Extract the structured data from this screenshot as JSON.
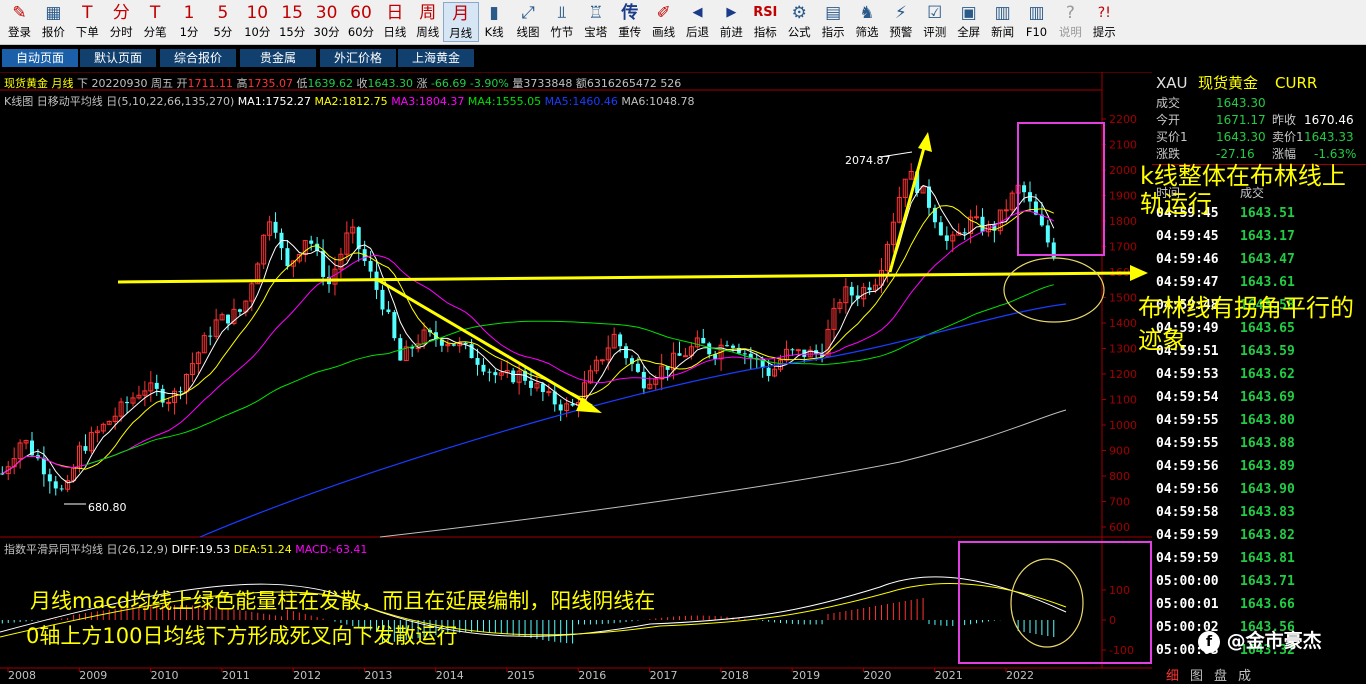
{
  "toolbar": [
    {
      "name": "login",
      "icon": "✎",
      "label": "登录"
    },
    {
      "name": "quote",
      "icon": "▦",
      "label": "报价"
    },
    {
      "name": "order",
      "icon": "T",
      "label": "下单"
    },
    {
      "name": "min-share",
      "icon": "分",
      "label": "分时"
    },
    {
      "name": "tick",
      "icon": "T",
      "label": "分笔"
    },
    {
      "name": "1min",
      "icon": "1",
      "label": "1分"
    },
    {
      "name": "5min",
      "icon": "5",
      "label": "5分"
    },
    {
      "name": "10min",
      "icon": "10",
      "label": "10分"
    },
    {
      "name": "15min",
      "icon": "15",
      "label": "15分"
    },
    {
      "name": "30min",
      "icon": "30",
      "label": "30分"
    },
    {
      "name": "60min",
      "icon": "60",
      "label": "60分"
    },
    {
      "name": "daily",
      "icon": "日",
      "label": "日线"
    },
    {
      "name": "weekly",
      "icon": "周",
      "label": "周线"
    },
    {
      "name": "monthly",
      "icon": "月",
      "label": "月线"
    },
    {
      "name": "kline",
      "icon": "▮",
      "label": "K线"
    },
    {
      "name": "line",
      "icon": "⤢",
      "label": "线图"
    },
    {
      "name": "bamboo",
      "icon": "⫫",
      "label": "竹节"
    },
    {
      "name": "pagoda",
      "icon": "♖",
      "label": "宝塔"
    },
    {
      "name": "overlay",
      "icon": "传",
      "label": "重传"
    },
    {
      "name": "draw",
      "icon": "✐",
      "label": "画线"
    },
    {
      "name": "back",
      "icon": "◀",
      "label": "后退"
    },
    {
      "name": "forward",
      "icon": "▶",
      "label": "前进"
    },
    {
      "name": "indicator",
      "icon": "RSI",
      "label": "指标"
    },
    {
      "name": "formula",
      "icon": "⚙",
      "label": "公式"
    },
    {
      "name": "guide",
      "icon": "▤",
      "label": "指示"
    },
    {
      "name": "filter",
      "icon": "♞",
      "label": "筛选"
    },
    {
      "name": "alert",
      "icon": "⚡",
      "label": "预警"
    },
    {
      "name": "review",
      "icon": "☑",
      "label": "评测"
    },
    {
      "name": "fullscreen",
      "icon": "▣",
      "label": "全屏"
    },
    {
      "name": "news",
      "icon": "▥",
      "label": "新闻"
    },
    {
      "name": "f10",
      "icon": "▥",
      "label": "F10"
    },
    {
      "name": "explain",
      "icon": "?",
      "label": "说明"
    },
    {
      "name": "tip",
      "icon": "?!",
      "label": "提示"
    }
  ],
  "tabs": [
    "自动页面",
    "默认页面",
    "综合报价",
    "贵金属",
    "外汇价格",
    "上海黄金"
  ],
  "info_bar": {
    "name": "现货黄金",
    "period": "月线",
    "dir": "下",
    "date": "20220930",
    "weekday": "周五",
    "open_label": "开",
    "open": "1711.11",
    "high_label": "高",
    "high": "1735.07",
    "low_label": "低",
    "low": "1639.62",
    "close_label": "收",
    "close": "1643.30",
    "chg_label": "涨",
    "chg": "-66.69",
    "pct": "-3.90%",
    "vol_label": "量",
    "vol": "3733848",
    "amt_label": "额",
    "amt": "6316265472",
    "extra": "526"
  },
  "ma_bar": {
    "title": "K线图 日移动平均线 日(5,10,22,66,135,270)",
    "ma1": "MA1:1752.27",
    "ma2": "MA2:1812.75",
    "ma3": "MA3:1804.37",
    "ma4": "MA4:1555.05",
    "ma5": "MA5:1460.46",
    "ma6": "MA6:1048.78"
  },
  "macd_bar": {
    "title": "指数平滑异同平均线 日(26,12,9)",
    "diff": "DIFF:19.53",
    "dea": "DEA:51.24",
    "macd": "MACD:-63.41"
  },
  "price_axis": [
    "2200",
    "2100",
    "2000",
    "1900",
    "1800",
    "1700",
    "1600",
    "1500",
    "1400",
    "1300",
    "1200",
    "1100",
    "1000",
    "900",
    "800",
    "700",
    "600"
  ],
  "macd_axis": [
    "100",
    "0",
    "-100"
  ],
  "year_axis": [
    "2008",
    "2009",
    "2010",
    "2011",
    "2012",
    "2013",
    "2014",
    "2015",
    "2016",
    "2017",
    "2018",
    "2019",
    "2020",
    "2021",
    "2022"
  ],
  "price_labels": {
    "high": "2074.87",
    "low": "680.80"
  },
  "right_panel": {
    "symbol": "XAU",
    "name": "现货黄金",
    "currency": "CURR",
    "last_label": "成交",
    "last": "1643.30",
    "open_label": "今开",
    "open": "1671.17",
    "prev_label": "昨收",
    "prev": "1670.46",
    "bid_label": "买价1",
    "bid": "1643.30",
    "ask_label": "卖价1",
    "ask": "1643.33",
    "chg_label": "涨跌",
    "chg": "-27.16",
    "pct_label": "涨幅",
    "pct": "-1.63%",
    "tick_header_time": "时间",
    "tick_header_price": "成交",
    "ticks": [
      [
        "04:59:45",
        "1643.51"
      ],
      [
        "04:59:45",
        "1643.17"
      ],
      [
        "04:59:46",
        "1643.47"
      ],
      [
        "04:59:47",
        "1643.61"
      ],
      [
        "04:59:48",
        "1643.58"
      ],
      [
        "04:59:49",
        "1643.65"
      ],
      [
        "04:59:51",
        "1643.59"
      ],
      [
        "04:59:53",
        "1643.62"
      ],
      [
        "04:59:54",
        "1643.69"
      ],
      [
        "04:59:55",
        "1643.80"
      ],
      [
        "04:59:55",
        "1643.88"
      ],
      [
        "04:59:56",
        "1643.89"
      ],
      [
        "04:59:56",
        "1643.90"
      ],
      [
        "04:59:58",
        "1643.83"
      ],
      [
        "04:59:59",
        "1643.82"
      ],
      [
        "04:59:59",
        "1643.81"
      ],
      [
        "05:00:00",
        "1643.71"
      ],
      [
        "05:00:01",
        "1643.66"
      ],
      [
        "05:00:02",
        "1643.56"
      ],
      [
        "05:00:03",
        "1643.32"
      ]
    ],
    "bottom_tabs": [
      "细",
      "图",
      "盘",
      "成"
    ]
  },
  "annotations": {
    "kline_note": "k线整体在布林线上轨运行",
    "boll_note": "布林线有拐角平行的迹象",
    "macd_note_1": "月线macd均线上绿色能量柱在发散，而且在延展编制，阳线阴线在",
    "macd_note_2": "0轴上方100日均线下方形成死叉向下发散运行",
    "watermark": "@金市豪杰"
  },
  "colors": {
    "up": "#ff3333",
    "down": "#54ffff",
    "ma1": "#ffffff",
    "ma2": "#ffff00",
    "ma3": "#ff00ff",
    "ma4": "#00e000",
    "ma5": "#1a3cff",
    "ma6": "#c0c0c0",
    "annotation": "#ffff00",
    "box": "#e040e0"
  }
}
